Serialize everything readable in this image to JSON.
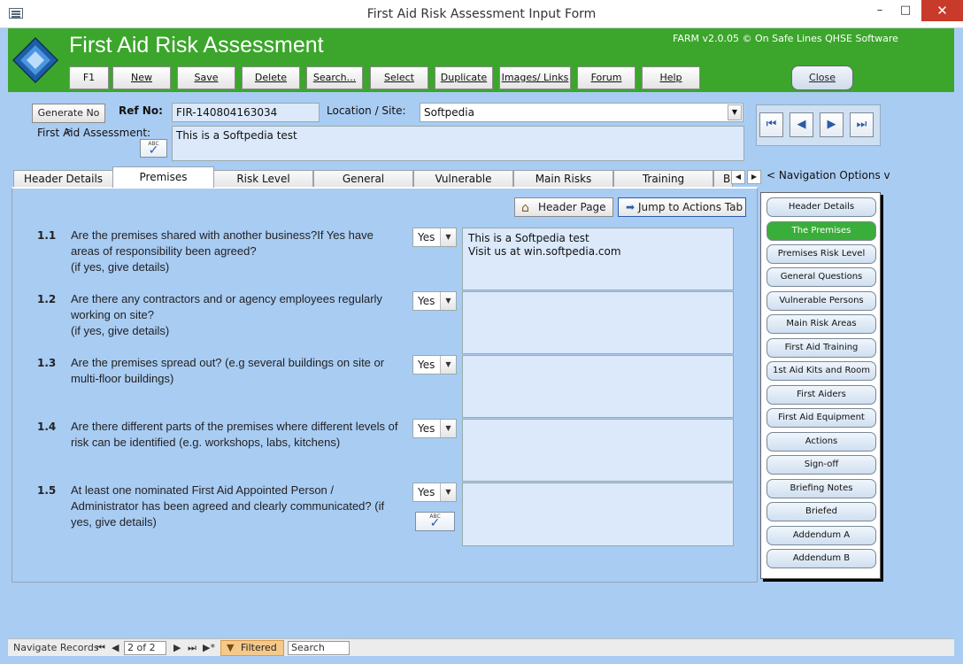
{
  "window": {
    "title": "First Aid Risk Assessment Input Form",
    "minimize": "–",
    "maximize": "□",
    "close": "✕"
  },
  "header": {
    "title": "First Aid Risk Assessment",
    "version": "FARM v2.0.05 © On Safe Lines QHSE Software",
    "brand_color": "#3ba62b",
    "toolbar": [
      "F1",
      "New",
      "Save",
      "Delete",
      "Search...",
      "Select",
      "Duplicate",
      "Images/ Links",
      "Forum",
      "Help"
    ],
    "close_label": "Close"
  },
  "form": {
    "generate_label": "Generate No >",
    "ref_label": "Ref No:",
    "ref_value": "FIR-140804163034",
    "location_label": "Location / Site:",
    "location_value": "Softpedia",
    "assessment_label": "First Aid Assessment:",
    "assessment_value": "This is a Softpedia test"
  },
  "record_nav": {
    "first": "⏮",
    "prev": "◀",
    "next": "▶",
    "last": "⏭"
  },
  "tabs": [
    "Header Details",
    "Premises",
    "Risk Level",
    "General",
    "Vulnerable",
    "Main Risks",
    "Training",
    "B"
  ],
  "active_tab": "Premises",
  "panel": {
    "header_page_label": "Header Page",
    "jump_label": "Jump to Actions Tab",
    "questions": [
      {
        "num": "1.1",
        "text": "Are the premises shared with another business?If Yes have areas of responsibility been agreed?\n(if yes, give details)",
        "answer": "Yes",
        "details": "This is a Softpedia test\nVisit us at win.softpedia.com"
      },
      {
        "num": "1.2",
        "text": "Are there any contractors and or agency employees regularly working on site?\n (if yes, give details)",
        "answer": "Yes",
        "details": ""
      },
      {
        "num": "1.3",
        "text": "Are the premises spread out? (e.g several buildings on site or multi-floor buildings)",
        "answer": "Yes",
        "details": ""
      },
      {
        "num": "1.4",
        "text": "Are there different parts of the premises where different levels of risk can be identified (e.g. workshops, labs, kitchens)",
        "answer": "Yes",
        "details": ""
      },
      {
        "num": "1.5",
        "text": "At least one nominated First Aid Appointed Person / Administrator has been agreed and clearly communicated?  (if yes, give details)",
        "answer": "Yes",
        "details": ""
      }
    ]
  },
  "nav_options": {
    "title": "< Navigation Options v",
    "items": [
      "Header Details",
      "The Premises",
      "Premises Risk Level",
      "General Questions",
      "Vulnerable Persons",
      "Main Risk Areas",
      "First Aid Training",
      "1st Aid Kits and Room",
      "First Aiders",
      "First Aid Equipment",
      "Actions",
      "Sign-off",
      "Briefing Notes",
      "Briefed",
      "Addendum A",
      "Addendum B"
    ],
    "active_index": 1
  },
  "statusbar": {
    "label": "Navigate Records",
    "record": "2 of 2",
    "filtered": "Filtered",
    "search": "Search"
  }
}
